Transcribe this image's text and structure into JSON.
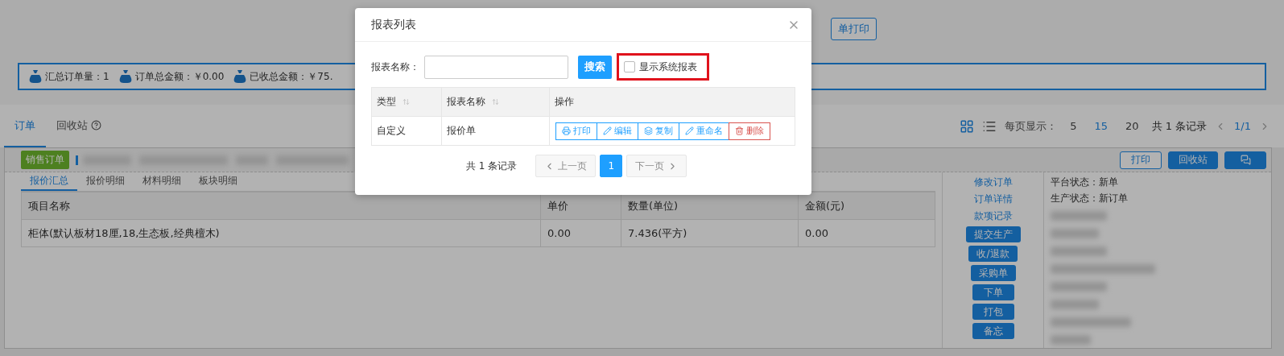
{
  "page": {
    "toolbar_button": "单打印",
    "summary": [
      "汇总订单量：1",
      "订单总金额：￥0.00",
      "已收总金额：￥75."
    ],
    "tabs": [
      {
        "label": "订单",
        "selected": true,
        "help": false
      },
      {
        "label": "回收站",
        "selected": false,
        "help": true
      }
    ],
    "page_size": {
      "label": "每页显示：",
      "options": [
        {
          "label": "5",
          "selected": false
        },
        {
          "label": "15",
          "selected": true
        },
        {
          "label": "20",
          "selected": false
        }
      ]
    },
    "record_count": "共 1 条记录",
    "page": "1/1",
    "order": {
      "badge": "销售订单",
      "actions": [
        {
          "kind": "outline",
          "label": "打印"
        },
        {
          "kind": "solid",
          "label": "回收站"
        },
        {
          "kind": "chat"
        }
      ]
    },
    "subtabs": [
      {
        "label": "报价汇总",
        "selected": true
      },
      {
        "label": "报价明细",
        "selected": false
      },
      {
        "label": "材料明细",
        "selected": false
      },
      {
        "label": "板块明细",
        "selected": false
      }
    ],
    "table": {
      "columns": [
        "项目名称",
        "单价",
        "数量(单位)",
        "金额(元)"
      ],
      "rows": [
        [
          "柜体(默认板材18厘,18,生态板,经典檀木)",
          "0.00",
          "7.436(平方)",
          "0.00"
        ]
      ]
    },
    "links": [
      "修改订单",
      "订单详情",
      "款项记录"
    ],
    "action_buttons": [
      "提交生产",
      "收/退款",
      "采购单",
      "下单",
      "打包",
      "备忘"
    ],
    "status": [
      {
        "label": "平台状态：",
        "value": "新单"
      },
      {
        "label": "生产状态：",
        "value": "新订单"
      }
    ]
  },
  "dialog": {
    "title": "报表列表",
    "search_label": "报表名称：",
    "search_button": "搜索",
    "show_system": {
      "label": "显示系统报表",
      "checked": false,
      "highlighted": true
    },
    "columns": [
      {
        "label": "类型",
        "sortable": true
      },
      {
        "label": "报表名称",
        "sortable": true
      },
      {
        "label": "操作",
        "sortable": false
      }
    ],
    "rows": [
      {
        "type": "自定义",
        "name": "报价单",
        "actions": [
          {
            "kind": "print",
            "label": "打印"
          },
          {
            "kind": "edit",
            "label": "编辑"
          },
          {
            "kind": "copy",
            "label": "复制"
          },
          {
            "kind": "rename",
            "label": "重命名"
          },
          {
            "kind": "delete",
            "label": "删除"
          }
        ]
      }
    ],
    "record_count": "共 1 条记录",
    "prev": {
      "label": "上一页",
      "disabled": true
    },
    "pages": [
      {
        "label": "1",
        "selected": true
      }
    ],
    "next": {
      "label": "下一页",
      "disabled": true
    }
  }
}
